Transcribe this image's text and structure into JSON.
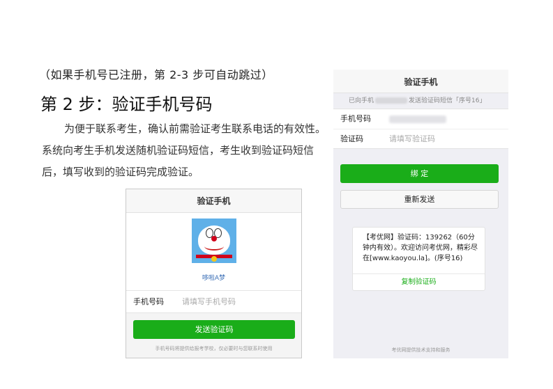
{
  "doc": {
    "note": "（如果手机号已注册，第 2-3 步可自动跳过）",
    "step_title": "第 2 步：验证手机号码",
    "paragraph": "为便于联系考生，确认前需验证考生联系电话的有效性。系统向考生手机发送随机验证码短信，考生收到验证码短信后，填写收到的验证码完成验证。"
  },
  "screenA": {
    "header": "验证手机",
    "avatar_icon": "doraemon-avatar",
    "nickname": "哆啦A梦",
    "phone_label": "手机号码",
    "phone_placeholder": "请填写手机号码",
    "send_button": "发送验证码",
    "footer": "手机号码将提供给报考学校，仅必要时与您联系时使用"
  },
  "screenB": {
    "header": "验证手机",
    "info_prefix": "已向手机",
    "info_suffix": "发送验证码短信「序号16」",
    "phone_label": "手机号码",
    "code_label": "验证码",
    "code_placeholder": "请填写验证码",
    "bind_button": "绑 定",
    "resend_button": "重新发送",
    "sms_text": "【考优网】验证码：139262（60分钟内有效）。欢迎访问考优网，精彩尽在[www.kaoyou.la]。(序号16)",
    "copy_button": "复制验证码",
    "footer": "考优网提供技术支持和服务"
  },
  "colors": {
    "primary_green": "#1aad19",
    "link_blue": "#3b6fb6"
  }
}
